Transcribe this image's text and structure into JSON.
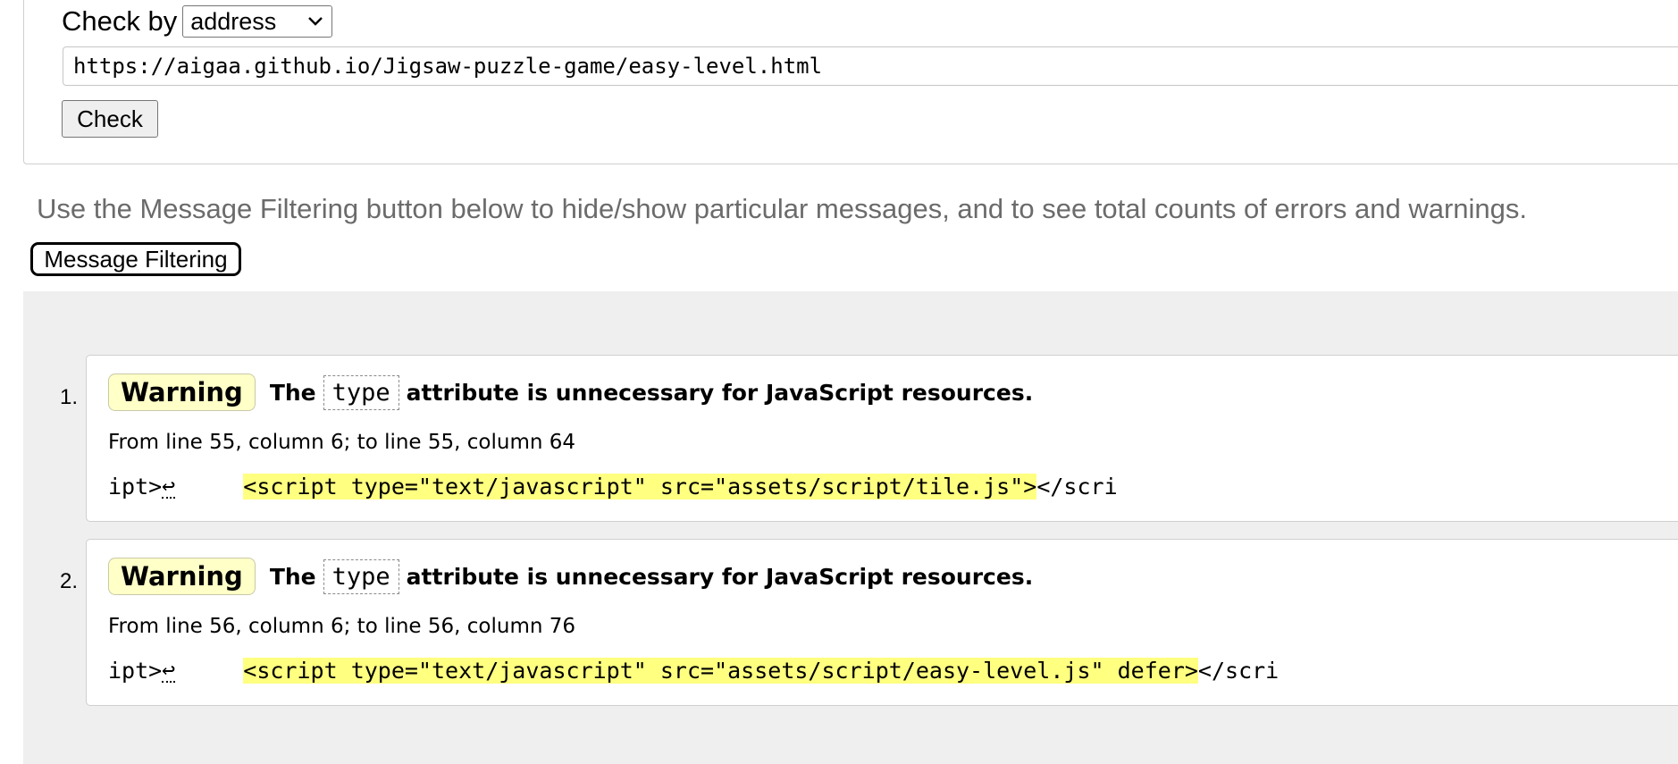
{
  "form": {
    "check_by_label": "Check by",
    "check_by_value": "address",
    "url_value": "https://aigaa.github.io/Jigsaw-puzzle-game/easy-level.html",
    "check_button_label": "Check"
  },
  "hint_text": "Use the Message Filtering button below to hide/show particular messages, and to see total counts of errors and warnings.",
  "filter_button_label": "Message Filtering",
  "colors": {
    "warning_badge": "#ffffc8",
    "extract_highlight": "#ffff80",
    "panel_background": "#efefef"
  },
  "messages": [
    {
      "number": "1.",
      "badge": "Warning",
      "text_before": "The",
      "code": "type",
      "text_after": "attribute is unnecessary for JavaScript resources.",
      "location": "From line 55, column 6; to line 55, column 64",
      "extract_before": "ipt>",
      "extract_newline": "↩",
      "extract_highlight": "<script type=\"text/javascript\" src=\"assets/script/tile.js\">",
      "extract_after": "</scri"
    },
    {
      "number": "2.",
      "badge": "Warning",
      "text_before": "The",
      "code": "type",
      "text_after": "attribute is unnecessary for JavaScript resources.",
      "location": "From line 56, column 6; to line 56, column 76",
      "extract_before": "ipt>",
      "extract_newline": "↩",
      "extract_highlight": "<script type=\"text/javascript\" src=\"assets/script/easy-level.js\" defer>",
      "extract_after": "</scri"
    }
  ]
}
